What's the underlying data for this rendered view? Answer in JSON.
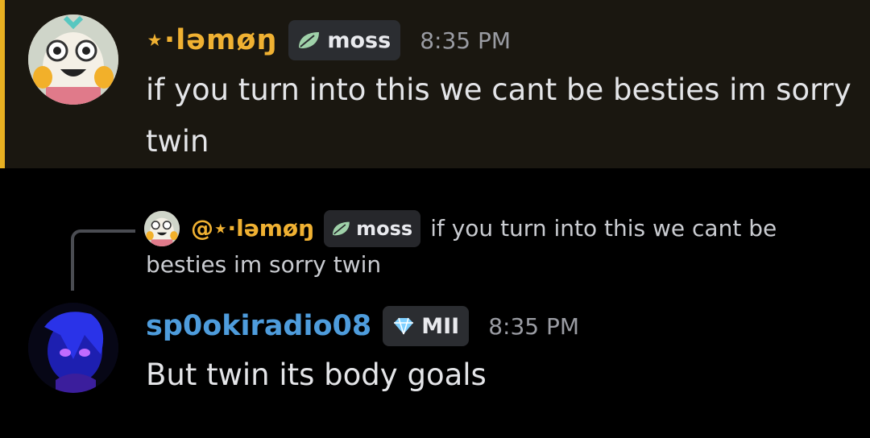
{
  "message1": {
    "username": "⋆·ləmøŋ",
    "tag_label": "moss",
    "tag_icon": "leaf-icon",
    "time": "8:35 PM",
    "text": "if you turn into this we cant be besties im sorry twin",
    "accent_color": "#e8b021",
    "username_color": "#f0b132"
  },
  "reply": {
    "mention": "@⋆·ləmøŋ",
    "tag_label": "moss",
    "tag_icon": "leaf-icon",
    "text_line1": "if you turn into this we cant be",
    "text_line2": "besties im sorry twin"
  },
  "message2": {
    "username": "sp0okiradio08",
    "tag_label": "MII",
    "tag_icon": "diamond-icon",
    "time": "8:35 PM",
    "text": "But twin its body goals",
    "username_color": "#4e9cdc"
  }
}
